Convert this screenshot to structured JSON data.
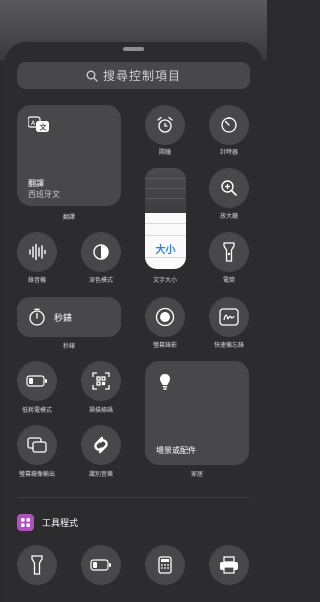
{
  "search": {
    "placeholder": "搜尋控制項目"
  },
  "tiles": {
    "translate": {
      "title": "翻譯",
      "subtitle": "西班牙文",
      "label": "翻譯"
    },
    "alarm": {
      "label": "鬧鐘"
    },
    "timer": {
      "label": "計時器"
    },
    "text_size": {
      "glyph": "大小",
      "label": "文字大小"
    },
    "magnifier": {
      "label": "放大鏡"
    },
    "voice_memos": {
      "label": "錄音機"
    },
    "dark_mode": {
      "label": "深色模式"
    },
    "flashlight": {
      "label": "電筒"
    },
    "stopwatch": {
      "title": "秒錶",
      "label": "秒錶"
    },
    "screen_recording": {
      "label": "螢幕錄影"
    },
    "quick_note": {
      "label": "快速備忘錄"
    },
    "low_power": {
      "label": "低耗電模式"
    },
    "code_scanner": {
      "label": "掃描條碼"
    },
    "home": {
      "title": "場景或配件",
      "label": "家居"
    },
    "screen_mirroring": {
      "label": "螢幕鏡像輸出"
    },
    "shazam": {
      "label": "識別音樂"
    }
  },
  "section": {
    "title": "工具程式",
    "icon": "grid-icon",
    "color": "#b150c0"
  },
  "colors": {
    "accent": "#2f7cf6",
    "tile": "#48484a",
    "background": "#2c2c2e"
  }
}
